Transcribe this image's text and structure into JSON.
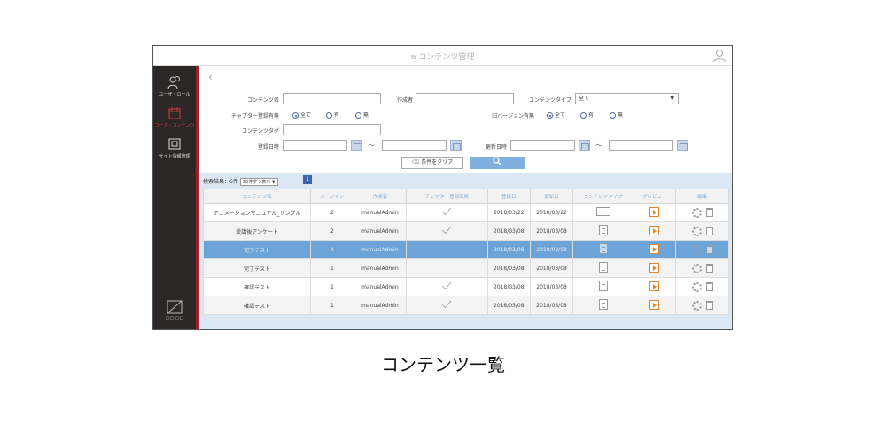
{
  "header": {
    "title": "コンテンツ管理"
  },
  "sidebar": {
    "items": [
      {
        "label": "ユーザ・ロール",
        "icon": "user-role-icon",
        "active": false
      },
      {
        "label": "コース・コンテンツ",
        "icon": "course-content-icon",
        "active": true
      },
      {
        "label": "サイト情報管理",
        "icon": "site-info-icon",
        "active": false
      }
    ],
    "bottom_label": "□□ □□"
  },
  "search": {
    "content_name_label": "コンテンツ名",
    "content_name_value": "",
    "creator_label": "作成者",
    "creator_value": "",
    "content_type_label": "コンテンツタイプ",
    "content_type_value": "全て",
    "chapter_label": "チャプター登録有無",
    "chapter_options": [
      "全て",
      "有",
      "無"
    ],
    "old_version_label": "旧バージョン有無",
    "old_version_options": [
      "全て",
      "有",
      "無"
    ],
    "tag_label": "コンテンツタグ",
    "tag_value": "",
    "reg_date_label": "登録日時",
    "upd_date_label": "更新日時",
    "tilde": "～",
    "clear_label": "条件をクリア"
  },
  "results": {
    "count_text": "検索結果：6件",
    "page_size": "20件ずつ表示 ▼",
    "page": "1",
    "columns": [
      "コンテンツ名",
      "バージョン",
      "作成者",
      "チャプター登録有無",
      "登録日",
      "更新日",
      "コンテンツタイプ",
      "プレビュー",
      "編集"
    ],
    "rows": [
      {
        "name": "アニメーションマニュアル_サンプル",
        "version": "2",
        "creator": "manualAdmin",
        "chapter": true,
        "registered": "2018/03/22",
        "updated": "2018/03/22",
        "type": "banner"
      },
      {
        "name": "受講後アンケート",
        "version": "2",
        "creator": "manualAdmin",
        "chapter": true,
        "registered": "2018/03/08",
        "updated": "2018/03/08",
        "type": "doc"
      },
      {
        "name": "完了テスト",
        "version": "4",
        "creator": "manualAdmin",
        "chapter": false,
        "registered": "2018/03/08",
        "updated": "2018/03/08",
        "type": "doc"
      },
      {
        "name": "完了テスト",
        "version": "1",
        "creator": "manualAdmin",
        "chapter": false,
        "registered": "2018/03/08",
        "updated": "2018/03/08",
        "type": "doc"
      },
      {
        "name": "確認テスト",
        "version": "1",
        "creator": "manualAdmin",
        "chapter": true,
        "registered": "2018/03/08",
        "updated": "2018/03/08",
        "type": "doc"
      },
      {
        "name": "確認テスト",
        "version": "1",
        "creator": "manualAdmin",
        "chapter": true,
        "registered": "2018/03/08",
        "updated": "2018/03/08",
        "type": "doc"
      }
    ],
    "selected_row": 2
  },
  "colors": {
    "sidebar_bg": "#2c2826",
    "sidebar_accent": "#a31d2b",
    "selected_row": "#6da4d8",
    "search_button": "#7fb0df",
    "preview_orange": "#e7842a"
  },
  "caption": "コンテンツ一覧"
}
